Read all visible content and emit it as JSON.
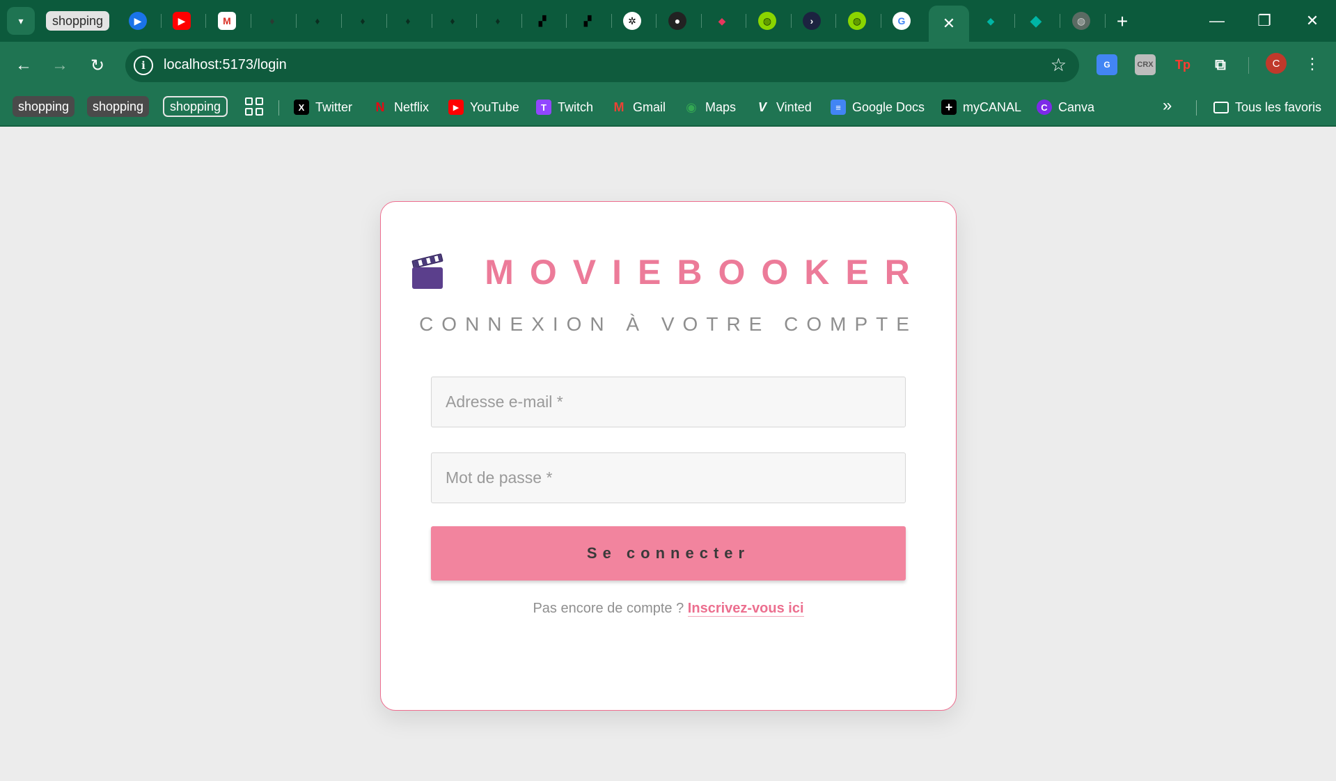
{
  "browser": {
    "tab_group_label": "shopping",
    "active_tab_close": "✕",
    "new_tab": "+",
    "window_controls": {
      "minimize": "—",
      "restore": "❐",
      "close": "✕"
    },
    "url": "localhost:5173/login",
    "profile_initial": "C",
    "extensions": [
      "translate-icon",
      "crx-icon",
      "tp-icon",
      "puzzle-icon"
    ],
    "extension_labels": {
      "crx": "CRX",
      "tp": "Tp"
    }
  },
  "bookmarks": {
    "groups": [
      "shopping",
      "shopping",
      "shopping"
    ],
    "items": [
      {
        "label": "Twitter",
        "icon": "X"
      },
      {
        "label": "Netflix",
        "icon": "N"
      },
      {
        "label": "YouTube",
        "icon": "▶"
      },
      {
        "label": "Twitch",
        "icon": "T"
      },
      {
        "label": "Gmail",
        "icon": "M"
      },
      {
        "label": "Maps",
        "icon": "◉"
      },
      {
        "label": "Vinted",
        "icon": "V"
      },
      {
        "label": "Google Docs",
        "icon": "≡"
      },
      {
        "label": "myCANAL",
        "icon": "+"
      },
      {
        "label": "Canva",
        "icon": "C"
      }
    ],
    "more": "»",
    "all_bookmarks": "Tous les favoris"
  },
  "login": {
    "brand": "MOVIEBOOKER",
    "subtitle": "CONNEXION À VOTRE COMPTE",
    "email_placeholder": "Adresse e-mail *",
    "password_placeholder": "Mot de passe *",
    "submit_label": "Se connecter",
    "signup_prompt": "Pas encore de compte ?",
    "signup_link": "Inscrivez-vous ici"
  },
  "colors": {
    "chrome_dark": "#0c5a3c",
    "chrome": "#1f7452",
    "accent_pink": "#ec7b99",
    "button_pink": "#f2849e",
    "page_bg": "#ececec"
  }
}
